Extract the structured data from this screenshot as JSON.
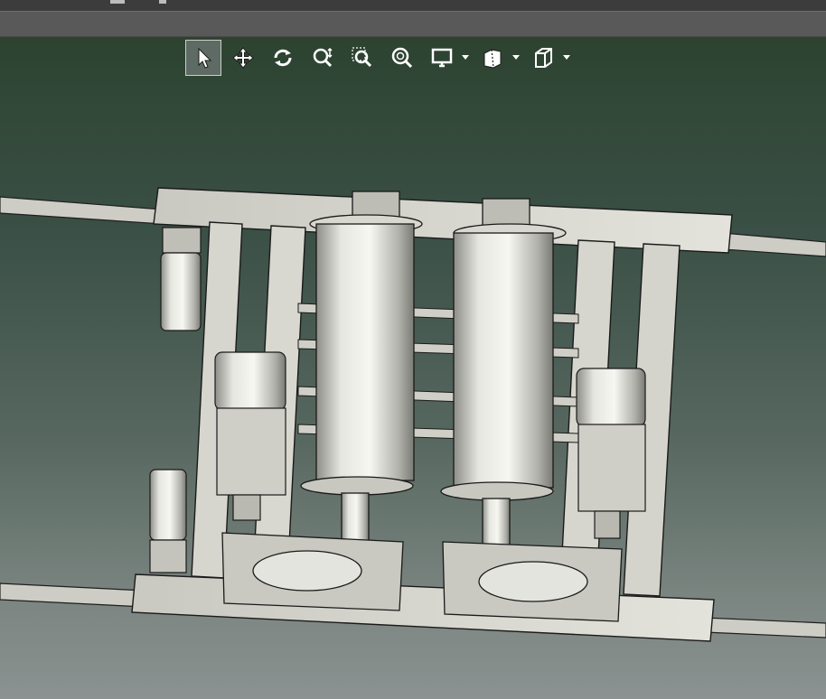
{
  "window": {
    "title": ""
  },
  "viewport": {
    "background_top": "#2d4330",
    "background_bottom": "#8b9291"
  },
  "toolbar": {
    "tools": [
      {
        "name": "select-tool",
        "icon": "arrow-cursor-icon",
        "active": true
      },
      {
        "name": "pan-tool",
        "icon": "move-arrows-icon",
        "active": false
      },
      {
        "name": "rotate-tool",
        "icon": "rotate-icon",
        "active": false
      },
      {
        "name": "zoom-tool",
        "icon": "zoom-icon",
        "active": false
      },
      {
        "name": "zoom-window-tool",
        "icon": "zoom-window-icon",
        "active": false
      },
      {
        "name": "zoom-fit-tool",
        "icon": "zoom-fit-icon",
        "active": false
      },
      {
        "name": "display-mode-dropdown",
        "icon": "monitor-icon",
        "dropdown": true
      },
      {
        "name": "section-view-dropdown",
        "icon": "section-cube-icon",
        "dropdown": true
      },
      {
        "name": "view-orientation-dropdown",
        "icon": "cube-icon",
        "dropdown": true
      }
    ]
  },
  "model": {
    "description_hidden": "",
    "colors": {
      "frame": "#d4d4cc",
      "edge": "#202020",
      "steel": "#c8c8c2",
      "shadow": "#8a8a84"
    }
  }
}
